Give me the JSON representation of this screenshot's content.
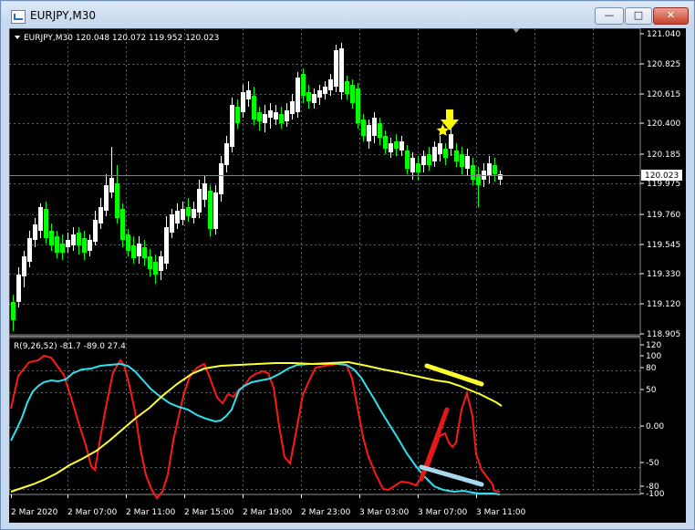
{
  "window": {
    "title": "EURJPY,M30",
    "buttons": {
      "minimize": "—",
      "maximize": "□",
      "close": "✕"
    }
  },
  "price_panel": {
    "header": "EURJPY,M30  120.048 120.072 119.952 120.023",
    "y_labels": [
      "121.040",
      "120.825",
      "120.615",
      "120.400",
      "120.185",
      "119.975",
      "119.760",
      "119.545",
      "119.330",
      "119.120",
      "118.905"
    ],
    "current_price": "120.023",
    "colors": {
      "bull": "#ffffff",
      "bear": "#00ff00",
      "grid": "#5f6366",
      "marker": "#ffff00"
    }
  },
  "indicator_panel": {
    "header": "R(9,26,52) -81.7 -89.0 27.4",
    "y_labels": [
      "120",
      "100",
      "80",
      "50",
      "0.00",
      "-50",
      "-80",
      "-100"
    ],
    "colors": {
      "fast": "#ff1818",
      "medium": "#2ee0f0",
      "slow": "#ffff30"
    }
  },
  "time_labels": [
    "2 Mar 2020",
    "2 Mar 07:00",
    "2 Mar 11:00",
    "2 Mar 15:00",
    "2 Mar 19:00",
    "2 Mar 23:00",
    "3 Mar 03:00",
    "3 Mar 07:00",
    "3 Mar 11:00"
  ]
}
